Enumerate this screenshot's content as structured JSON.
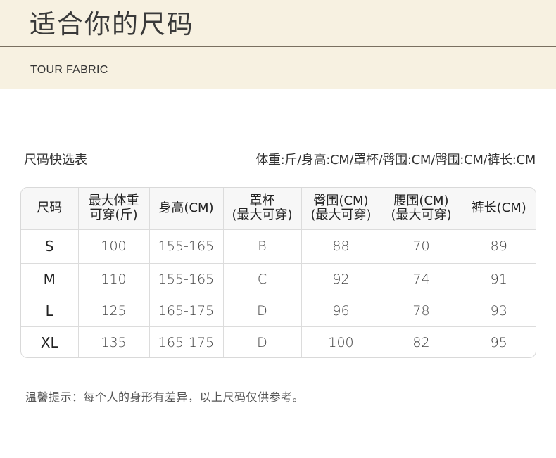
{
  "banner": {
    "title": "适合你的尺码",
    "subtitle": "TOUR FABRIC"
  },
  "quick_table": {
    "title": "尺码快选表",
    "units_note": "体重:斤/身高:CM/罩杯/臀围:CM/臀围:CM/裤长:CM"
  },
  "headers": [
    [
      "尺码"
    ],
    [
      "最大体重",
      "可穿(斤)"
    ],
    [
      "身高(CM)"
    ],
    [
      "罩杯",
      "(最大可穿)"
    ],
    [
      "臀围(CM)",
      "(最大可穿)"
    ],
    [
      "腰围(CM)",
      "(最大可穿)"
    ],
    [
      "裤长(CM)"
    ]
  ],
  "rows": [
    [
      "S",
      "100",
      "155-165",
      "B",
      "88",
      "70",
      "89"
    ],
    [
      "M",
      "110",
      "155-165",
      "C",
      "92",
      "74",
      "91"
    ],
    [
      "L",
      "125",
      "165-175",
      "D",
      "96",
      "78",
      "93"
    ],
    [
      "XL",
      "135",
      "165-175",
      "D",
      "100",
      "82",
      "95"
    ]
  ],
  "tip": "温馨提示：每个人的身形有差异，以上尺码仅供参考。"
}
